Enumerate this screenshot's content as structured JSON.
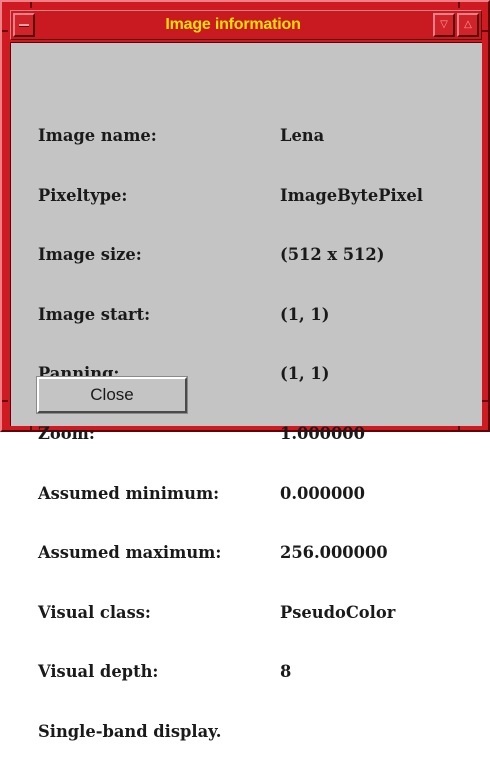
{
  "window": {
    "title": "Image information",
    "frame_color": "#cf1a22",
    "title_color": "#ffe000",
    "background": "#c4c4c4"
  },
  "titlebar": {
    "menu_icon": "window-menu-icon",
    "minimize_icon": "triangle-down-icon",
    "maximize_icon": "triangle-up-icon"
  },
  "info": {
    "rows": [
      {
        "label": "Image name:",
        "value": "Lena"
      },
      {
        "label": "Pixeltype:",
        "value": "ImageBytePixel"
      },
      {
        "label": "Image size:",
        "value": "(512 x 512)"
      },
      {
        "label": "Image start:",
        "value": "(1, 1)"
      },
      {
        "label": "Panning:",
        "value": "(1, 1)"
      },
      {
        "label": "Zoom:",
        "value": "1.000000"
      },
      {
        "label": "Assumed minimum:",
        "value": "0.000000"
      },
      {
        "label": "Assumed maximum:",
        "value": "256.000000"
      },
      {
        "label": "Visual class:",
        "value": "PseudoColor"
      },
      {
        "label": "Visual depth:",
        "value": "8"
      }
    ],
    "footer": "Single-band display."
  },
  "buttons": {
    "close_label": "Close"
  }
}
